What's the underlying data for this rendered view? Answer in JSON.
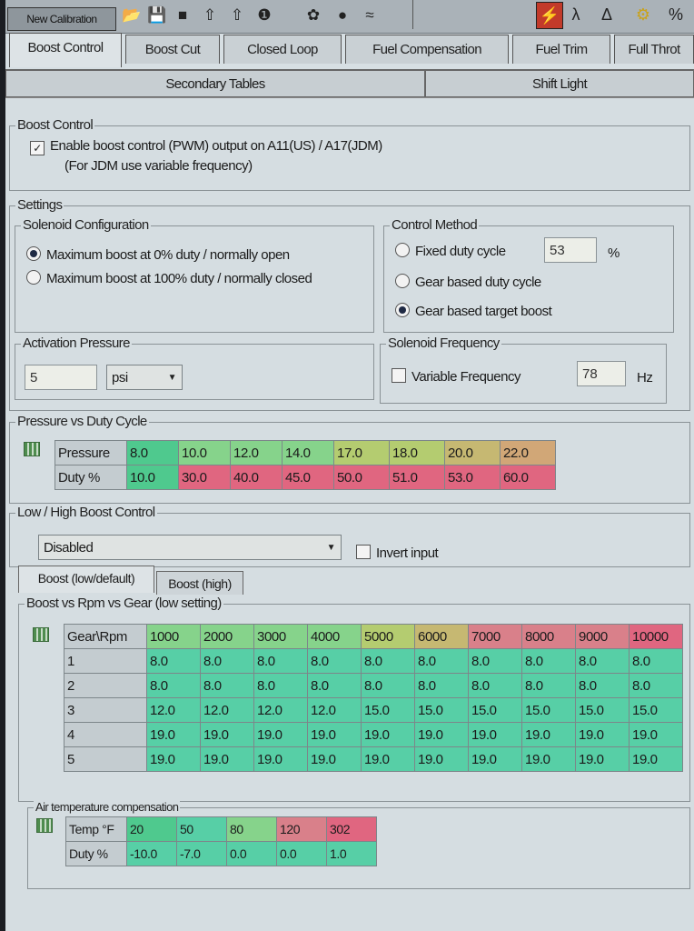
{
  "toolbar": {
    "new_calibration": "New Calibration"
  },
  "tabs": [
    {
      "label": "Boost Control",
      "active": true
    },
    {
      "label": "Boost Cut"
    },
    {
      "label": "Closed Loop"
    },
    {
      "label": "Fuel Compensation"
    },
    {
      "label": "Fuel Trim"
    },
    {
      "label": "Full Throt"
    }
  ],
  "subtabs": [
    {
      "label": "Secondary Tables"
    },
    {
      "label": "Shift Light"
    }
  ],
  "boost_control": {
    "legend": "Boost Control",
    "enable_label": "Enable boost control (PWM) output on A11(US) / A17(JDM)",
    "enable_checked": true,
    "note": "(For JDM use variable frequency)"
  },
  "settings": {
    "legend": "Settings",
    "solenoid": {
      "legend": "Solenoid Configuration",
      "opt1": "Maximum boost at 0% duty / normally open",
      "opt2": "Maximum boost at 100% duty / normally closed"
    },
    "control_method": {
      "legend": "Control Method",
      "opt1": "Fixed duty cycle",
      "fixed_value": "53",
      "fixed_unit": "%",
      "opt2": "Gear based duty cycle",
      "opt3": "Gear based target boost"
    },
    "activation": {
      "legend": "Activation Pressure",
      "value": "5",
      "unit": "psi"
    },
    "frequency": {
      "legend": "Solenoid Frequency",
      "variable_label": "Variable Frequency",
      "value": "78",
      "unit": "Hz"
    }
  },
  "pressure_duty": {
    "legend": "Pressure vs Duty Cycle",
    "row1_label": "Pressure",
    "row2_label": "Duty %",
    "pressure": [
      "8.0",
      "10.0",
      "12.0",
      "14.0",
      "17.0",
      "18.0",
      "20.0",
      "22.0"
    ],
    "duty": [
      "10.0",
      "30.0",
      "40.0",
      "45.0",
      "50.0",
      "51.0",
      "53.0",
      "60.0"
    ]
  },
  "low_high": {
    "legend": "Low / High Boost Control",
    "select_value": "Disabled",
    "invert_label": "Invert input"
  },
  "inner_tabs": [
    {
      "label": "Boost (low/default)",
      "active": true
    },
    {
      "label": "Boost (high)"
    }
  ],
  "boost_rpm": {
    "legend": "Boost vs Rpm vs Gear (low setting)",
    "corner": "Gear\\Rpm",
    "rpm": [
      "1000",
      "2000",
      "3000",
      "4000",
      "5000",
      "6000",
      "7000",
      "8000",
      "9000",
      "10000"
    ],
    "gears": [
      "1",
      "2",
      "3",
      "4",
      "5"
    ],
    "values": [
      [
        "8.0",
        "8.0",
        "8.0",
        "8.0",
        "8.0",
        "8.0",
        "8.0",
        "8.0",
        "8.0",
        "8.0"
      ],
      [
        "8.0",
        "8.0",
        "8.0",
        "8.0",
        "8.0",
        "8.0",
        "8.0",
        "8.0",
        "8.0",
        "8.0"
      ],
      [
        "12.0",
        "12.0",
        "12.0",
        "12.0",
        "15.0",
        "15.0",
        "15.0",
        "15.0",
        "15.0",
        "15.0"
      ],
      [
        "19.0",
        "19.0",
        "19.0",
        "19.0",
        "19.0",
        "19.0",
        "19.0",
        "19.0",
        "19.0",
        "19.0"
      ],
      [
        "19.0",
        "19.0",
        "19.0",
        "19.0",
        "19.0",
        "19.0",
        "19.0",
        "19.0",
        "19.0",
        "19.0"
      ]
    ]
  },
  "air_temp": {
    "legend": "Air temperature compensation",
    "row1_label": "Temp °F",
    "row2_label": "Duty %",
    "temps": [
      "20",
      "50",
      "80",
      "120",
      "302"
    ],
    "duty": [
      "-10.0",
      "-7.0",
      "0.0",
      "0.0",
      "1.0"
    ]
  },
  "colors": {
    "green": "#4fc98e",
    "light_green": "#86d38b",
    "yellow_green": "#b4cc70",
    "tan": "#c6b872",
    "orange": "#d1a777",
    "salmon": "#d9808a",
    "red": "#e06680",
    "teal": "#57cfa6"
  }
}
